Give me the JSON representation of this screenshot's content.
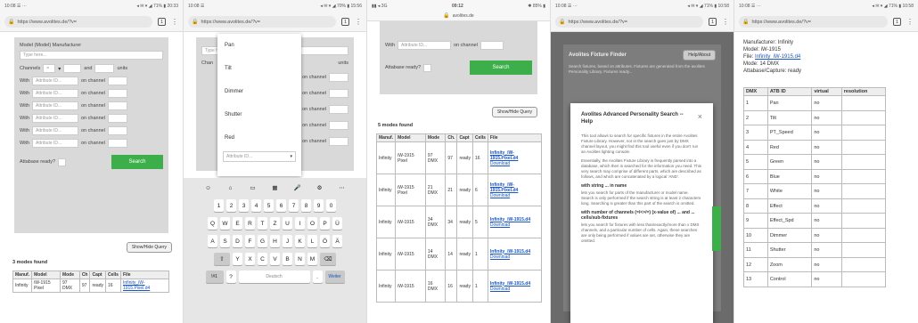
{
  "phone1": {
    "status_left": "10:08 ☰ ···",
    "status_right": "◂ ✉ ▾ ◢ 71% ▮ 20:33",
    "url": "https://www.avolites.de/?v=",
    "tabs_count": "1",
    "form": {
      "model_label": "Model (Model) Manufacturer",
      "type_here": "Type here...",
      "channels_label": "Channels",
      "channels_op": "=",
      "and_label": "and",
      "units_label": "units",
      "with_label": "With",
      "attr_placeholder": "Attribute ID...",
      "on_channel": "on channel",
      "rows": [
        "With",
        "With",
        "With",
        "With",
        "With",
        "With"
      ],
      "atabase_label": "Attabase ready?",
      "search_button": "Search",
      "show_hide_query": "Show/Hide Query",
      "modes_found": "3 modes found"
    },
    "table_headers": [
      "Manuf.",
      "Model",
      "Mode",
      "Ch",
      "Capt",
      "Cells",
      "File"
    ],
    "table_rows": [
      [
        "Infinity",
        "iW-1915 Pixel",
        "97 DMX",
        "97",
        "ready",
        "16",
        "Infinity_iW-1915.Pixel.d4"
      ]
    ]
  },
  "phone2": {
    "status_left": "10:08 ☰",
    "status_right": "◂ ✉ ▾ ◢ 70% ▮ 15:56",
    "url": "https://www.avolites.de/?v=",
    "tabs_count": "1",
    "dropdown_items": [
      "Pan",
      "Tilt",
      "Dimmer",
      "Shutter",
      "Red"
    ],
    "selected_placeholder": "Attribute ID...",
    "form": {
      "type_here": "Type here...",
      "channels_label": "Chan",
      "units_label": "units",
      "on_channel": "on channel",
      "attr_placeholder": "Attribute ID..."
    },
    "keyboard": {
      "row0": [
        "☺",
        "⌂",
        "▭",
        "▦",
        "🎤",
        "⚙",
        "⋯"
      ],
      "row1": [
        "1",
        "2",
        "3",
        "4",
        "5",
        "6",
        "7",
        "8",
        "9",
        "0"
      ],
      "row2": [
        "Q",
        "W",
        "E",
        "R",
        "T",
        "Z",
        "U",
        "I",
        "O",
        "P",
        "Ü"
      ],
      "row3": [
        "A",
        "S",
        "D",
        "F",
        "G",
        "H",
        "J",
        "K",
        "L",
        "Ö",
        "Ä"
      ],
      "row4": [
        "⇧",
        "Y",
        "X",
        "C",
        "V",
        "B",
        "N",
        "M",
        "⌫"
      ],
      "row5": [
        "!#1",
        "?",
        "Deutsch",
        ".",
        "Weiter"
      ]
    }
  },
  "phone3": {
    "status_left": "▮▮ ◂ 3G",
    "status_time": "09:12",
    "status_right": "✱ 85% ▮",
    "url": "avolites.de",
    "form": {
      "with_label": "With",
      "attr_placeholder": "Attribute ID...",
      "on_channel": "on channel",
      "atabase_label": "Attabase ready?",
      "search_button": "Search",
      "show_hide_query": "Show/Hide Query",
      "modes_found": "5 modes found"
    },
    "table_headers": [
      "Manuf.",
      "Model",
      "Mode",
      "Ch.",
      "Capt",
      "Cells",
      "File"
    ],
    "table_rows": [
      [
        "Infinity",
        "iW-1915 Pixel",
        "97 DMX",
        "97",
        "ready",
        "16",
        "Infinity_iW-1915.Pixel.d4",
        "Download"
      ],
      [
        "Infinity",
        "iW-1915 Pixel",
        "21 DMX",
        "21",
        "ready",
        "6",
        "Infinity_iW-1915.Pixel.d4",
        "Download"
      ],
      [
        "Infinity",
        "iW-1915",
        "34 DMX",
        "34",
        "ready",
        "5",
        "Infinity_iW-1915.d4",
        "Download"
      ],
      [
        "Infinity",
        "iW-1915",
        "14 DMX",
        "14",
        "ready",
        "1",
        "Infinity_iW-1915.d4",
        "Download"
      ],
      [
        "Infinity",
        "iW-1915",
        "16 DMX",
        "16",
        "ready",
        "1",
        "Infinity_iW-1915.d4",
        "Download"
      ]
    ]
  },
  "phone4": {
    "status_left": "10:08 ☰ ···",
    "status_right": "◂ ✉ ▾ ◢ 71% ▮ 10:58",
    "url": "https://www.avolites.de/?v=",
    "tabs_count": "1",
    "finder_title": "Avolites Fixture Finder",
    "help_button": "Help/About",
    "finder_intro": "Search fixtures, based on attributes. Fixtures are generated from the avolites Personality Library. Fixtures ready...",
    "dialog_title": "Avolites Advanced Personality Search -- Help",
    "close": "×",
    "paragraphs": [
      "This tool allows to search for specific fixtures in the entire Avolites Fixture Library. However, not in the search goes just by DMX channel layout, you might find this tool useful even if you don't run an Avolites lighting console.",
      "Essentially, the Avolites Fixture Library is frequently parsed into a database, which then is searched for the information you need. This very search may comprise of different parts, which are described as follows, and which are concatenated by a logical 'AND'."
    ],
    "section1_title": "with string ... in name",
    "section1_text": "lets you search for parts of the manufacturer or model name. Search is only performed if the search string is at least 2 characters long. Searching is greater than this part of the search is omitted.",
    "section2_title": "with number of channels (=/<>/=) (x-value of) ... and ... cells/sub-fixtures",
    "section2_text": "lets you search for fixtures with less than/exactly/more than x DMX channels, and a particular number of cells. Again, these searches are only being performed if values are set, otherwise they are omitted."
  },
  "phone5": {
    "status_left": "10:08 ☰ ···",
    "status_right": "◂ ✉ ▾ ◢ 71% ▮ 10:58",
    "url": "https://www.avolites.de/?v=",
    "tabs_count": "1",
    "info": {
      "manufacturer": "Manufacturer: Infinity",
      "model": "Model: iW-1915",
      "file_label": "File: ",
      "file_link": "Infinity_iW-1915.d4",
      "mode": "Mode: 14 DMX",
      "atabase": "Attabase/Capture: ready"
    },
    "table_headers": [
      "DMX",
      "ATB ID",
      "virtual",
      "resolution"
    ],
    "table_rows": [
      [
        "1",
        "Pan",
        "no",
        ""
      ],
      [
        "2",
        "Tilt",
        "no",
        ""
      ],
      [
        "3",
        "PT_Speed",
        "no",
        ""
      ],
      [
        "4",
        "Red",
        "no",
        ""
      ],
      [
        "5",
        "Green",
        "no",
        ""
      ],
      [
        "6",
        "Blue",
        "no",
        ""
      ],
      [
        "7",
        "White",
        "no",
        ""
      ],
      [
        "8",
        "Effect",
        "no",
        ""
      ],
      [
        "9",
        "Effect_Spd",
        "no",
        ""
      ],
      [
        "10",
        "Dimmer",
        "no",
        ""
      ],
      [
        "11",
        "Shutter",
        "no",
        ""
      ],
      [
        "12",
        "Zoom",
        "no",
        ""
      ],
      [
        "13",
        "Control",
        "no",
        ""
      ]
    ]
  },
  "colors": {
    "accent_green": "#3cae4a",
    "link_blue": "#1a55c4",
    "form_gray": "#d9d9d9"
  }
}
